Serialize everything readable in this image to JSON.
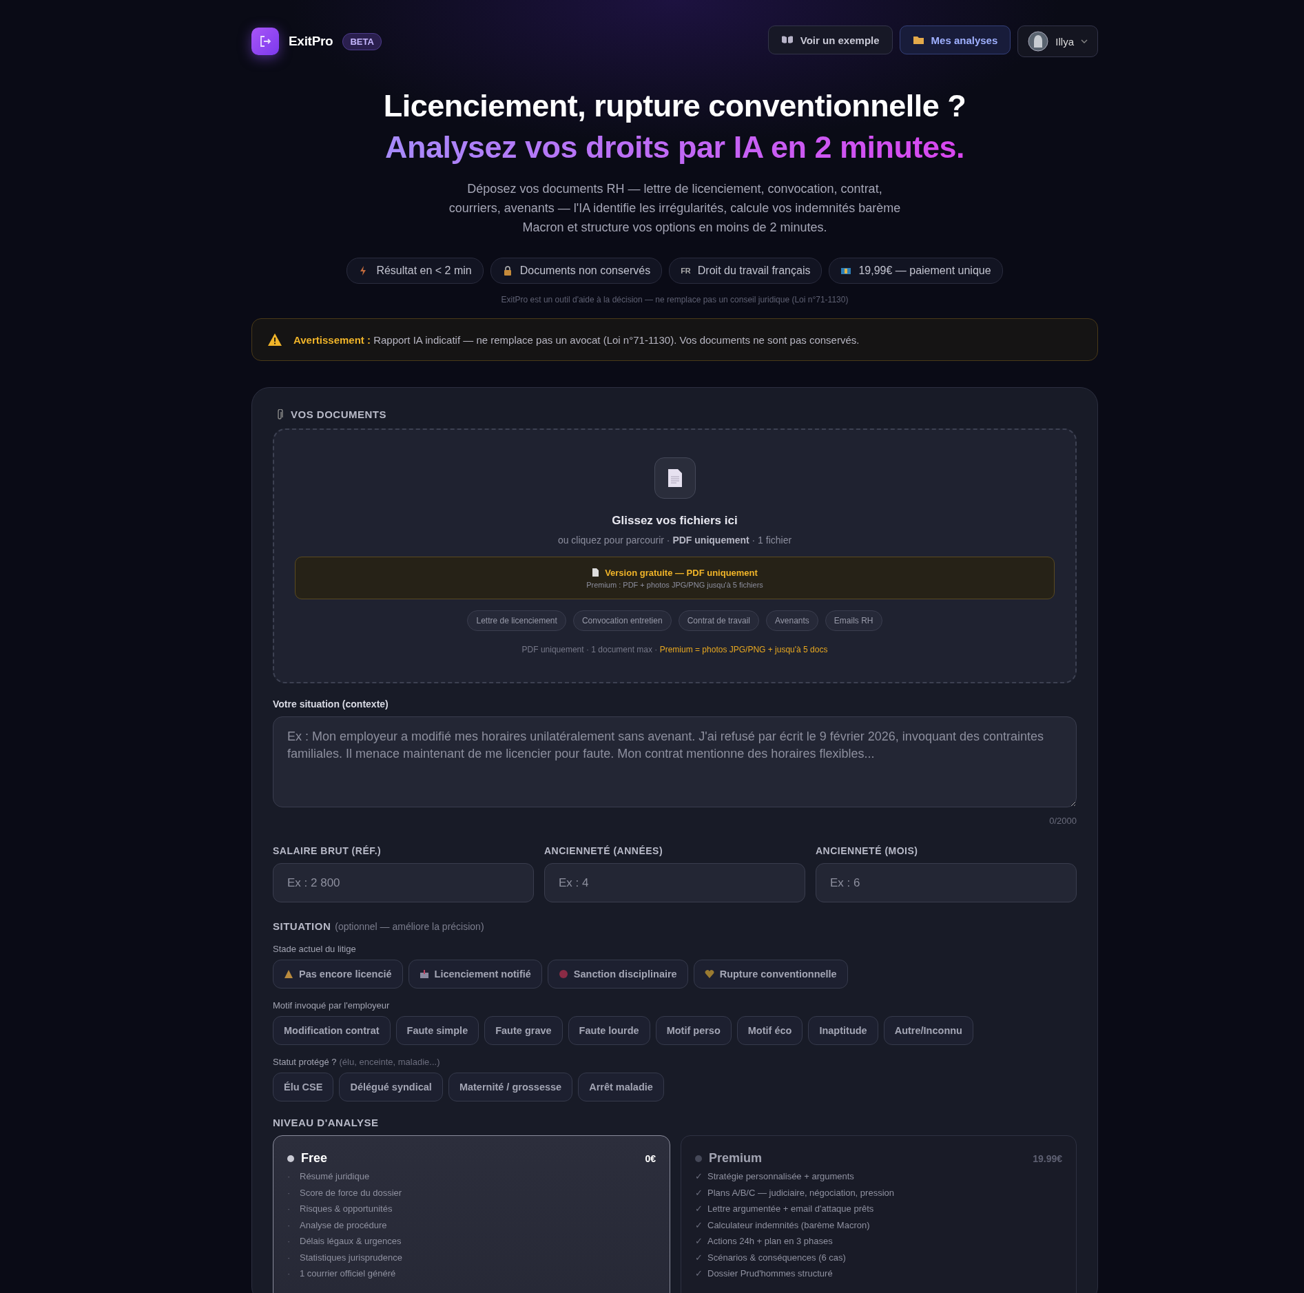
{
  "header": {
    "brand": "ExitPro",
    "badge": "BETA",
    "actions": [
      {
        "kind": "example",
        "label": "Voir un exemple"
      },
      {
        "kind": "analyses",
        "label": "Mes analyses"
      }
    ],
    "user": {
      "name": "Illya"
    }
  },
  "hero": {
    "title": "Licenciement, rupture conventionnelle ?",
    "highlight": "Analysez vos droits par IA en 2 minutes.",
    "description": "Déposez vos documents RH — lettre de licenciement, convocation, contrat, courriers, avenants — l'IA identifie les irrégularités, calcule vos indemnités barème Macron et structure vos options en moins de 2 minutes.",
    "badges": [
      {
        "kind": "speed",
        "label": "Résultat en < 2 min"
      },
      {
        "kind": "privacy",
        "label": "Documents non conservés"
      },
      {
        "kind": "law",
        "prefix": "FR",
        "label": "Droit du travail français"
      },
      {
        "kind": "price",
        "label": "19,99€ — paiement unique"
      }
    ],
    "note": "ExitPro est un outil d'aide à la décision — ne remplace pas un conseil juridique (Loi n°71-1130)"
  },
  "warning": {
    "label": "Avertissement :",
    "text": "Rapport IA indicatif — ne remplace pas un avocat (Loi n°71-1130). Vos documents ne sont pas conservés."
  },
  "documents": {
    "title": "VOS DOCUMENTS",
    "drop_title": "Glissez vos fichiers ici",
    "drop_hint": "ou cliquez pour parcourir · **PDF uniquement** · 1 fichier",
    "notice_title": "Version gratuite — PDF uniquement",
    "notice_sub": "Premium : PDF + photos JPG/PNG jusqu'à 5 fichiers",
    "types": [
      "Lettre de licenciement",
      "Convocation entretien",
      "Contrat de travail",
      "Avenants",
      "Emails RH"
    ],
    "footer": "PDF uniquement · 1 document max · ",
    "footer_premium": "Premium = photos JPG/PNG + jusqu'à 5 docs"
  },
  "context": {
    "label": "Votre situation (contexte)",
    "placeholder": "Ex : Mon employeur a modifié mes horaires unilatéralement sans avenant. J'ai refusé par écrit le 9 février 2026, invoquant des contraintes familiales. Il menace maintenant de me licencier pour faute. Mon contrat mentionne des horaires flexibles...",
    "counter": "0/2000"
  },
  "fields": [
    {
      "label": "SALAIRE BRUT (RÉF.)",
      "placeholder": "Ex : 2 800"
    },
    {
      "label": "ANCIENNETÉ (ANNÉES)",
      "placeholder": "Ex : 4"
    },
    {
      "label": "ANCIENNETÉ (MOIS)",
      "placeholder": "Ex : 6"
    }
  ],
  "situation": {
    "title": "SITUATION",
    "hint": "(optionnel — améliore la précision)",
    "groups": [
      {
        "label": "Stade actuel du litige",
        "options": [
          {
            "label": "Pas encore licencié",
            "kind": "warning",
            "selected": false
          },
          {
            "label": "Licenciement notifié",
            "kind": "mail",
            "selected": false
          },
          {
            "label": "Sanction disciplinaire",
            "kind": "dot",
            "selected": false
          },
          {
            "label": "Rupture conventionnelle",
            "kind": "heart",
            "selected": false
          }
        ]
      },
      {
        "label": "Motif invoqué par l'employeur",
        "options": [
          {
            "label": "Modification contrat",
            "selected": false
          },
          {
            "label": "Faute simple",
            "selected": false
          },
          {
            "label": "Faute grave",
            "selected": false
          },
          {
            "label": "Faute lourde",
            "selected": false
          },
          {
            "label": "Motif perso",
            "selected": false
          },
          {
            "label": "Motif éco",
            "selected": false
          },
          {
            "label": "Inaptitude",
            "selected": false
          },
          {
            "label": "Autre/Inconnu",
            "selected": false
          }
        ]
      },
      {
        "label": "Statut protégé ?",
        "hint": "(élu, enceinte, maladie...)",
        "options": [
          {
            "label": "Élu CSE",
            "selected": false
          },
          {
            "label": "Délégué syndical",
            "selected": false
          },
          {
            "label": "Maternité / grossesse",
            "selected": false
          },
          {
            "label": "Arrêt maladie",
            "selected": false
          }
        ]
      }
    ]
  },
  "analysis": {
    "title": "NIVEAU D'ANALYSE",
    "tiers": [
      {
        "name": "Free",
        "price": "0€",
        "selected": true,
        "marker": "·",
        "features": [
          "Résumé juridique",
          "Score de force du dossier",
          "Risques & opportunités",
          "Analyse de procédure",
          "Délais légaux & urgences",
          "Statistiques jurisprudence",
          "1 courrier officiel généré"
        ]
      },
      {
        "name": "Premium",
        "price": "19.99€",
        "selected": false,
        "marker": "✓",
        "features": [
          "Stratégie personnalisée + arguments",
          "Plans A/B/C — judiciaire, négociation, pression",
          "Lettre argumentée + email d'attaque prêts",
          "Calculateur indemnités (barème Macron)",
          "Actions 24h + plan en 3 phases",
          "Scénarios & conséquences (6 cas)",
          "Dossier Prud'hommes structuré"
        ]
      }
    ]
  }
}
